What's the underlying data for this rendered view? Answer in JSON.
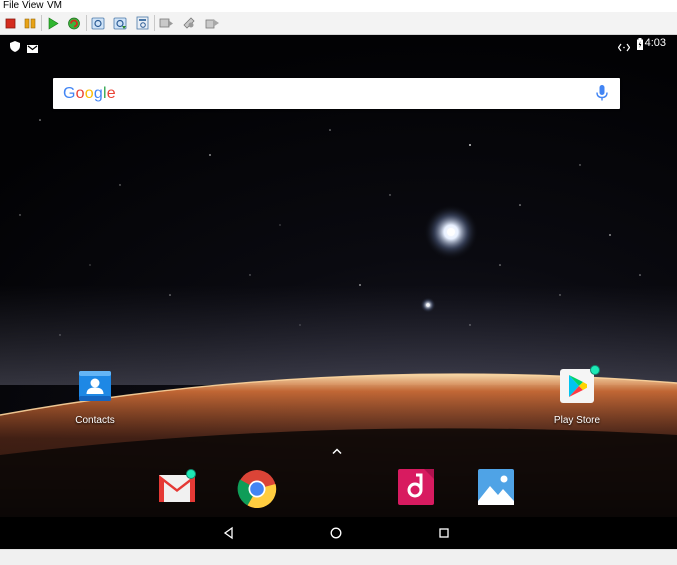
{
  "menubar": {
    "items": [
      "File",
      "View",
      "VM"
    ]
  },
  "toolbar": {
    "buttons": [
      "stop-icon",
      "pause-icon",
      "play-icon",
      "restart-icon",
      "snapshot-icon",
      "snapshot-revert-icon",
      "snapshot-manager-icon",
      "send-keys-icon",
      "settings-icon",
      "usb-icon"
    ]
  },
  "statusbar": {
    "time": "4:03",
    "icons": [
      "shield-icon",
      "gmail-notification-icon",
      "data-transfer-icon",
      "battery-icon"
    ]
  },
  "search": {
    "logo": [
      "G",
      "o",
      "o",
      "g",
      "l",
      "e"
    ],
    "logo_colors": [
      "#4285F4",
      "#EA4335",
      "#FBBC05",
      "#4285F4",
      "#34A853",
      "#EA4335"
    ]
  },
  "apps": {
    "contacts": "Contacts",
    "play_store": "Play Store"
  },
  "dock": [
    "gmail-icon",
    "chrome-icon",
    "music-icon",
    "photos-icon"
  ],
  "navbar": [
    "back-icon",
    "home-icon",
    "recents-icon"
  ],
  "colors": {
    "accent_dot": "#1de9b6",
    "contacts_blue": "#2196f3"
  }
}
